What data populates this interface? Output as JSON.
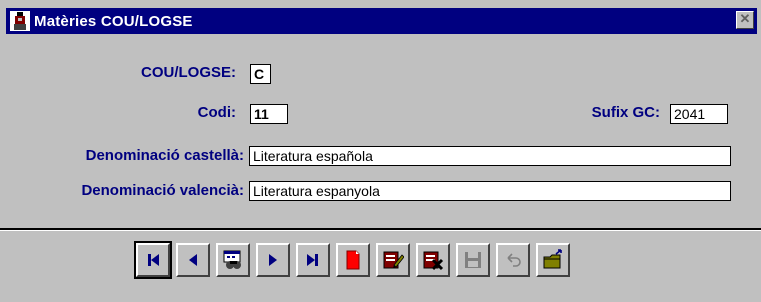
{
  "window": {
    "title": "Matèries COU/LOGSE",
    "close_label": "✕"
  },
  "form": {
    "cou_logse": {
      "label": "COU/LOGSE:",
      "value": "C"
    },
    "codi": {
      "label": "Codi:",
      "value": "11"
    },
    "sufix_gc": {
      "label": "Sufix GC:",
      "value": "2041"
    },
    "denominacio_castella": {
      "label": "Denominació castellà:",
      "value": "Literatura española"
    },
    "denominacio_valencia": {
      "label": "Denominació valencià:",
      "value": "Literatura espanyola"
    }
  },
  "toolbar": {
    "icons": [
      "first-record-icon",
      "previous-record-icon",
      "find-icon",
      "next-record-icon",
      "last-record-icon",
      "new-record-icon",
      "edit-record-icon",
      "delete-record-icon",
      "save-icon",
      "undo-icon",
      "exit-icon"
    ],
    "colors": {
      "nav_blue": "#000080",
      "new_red": "#ff0000",
      "disabled": "#808080"
    }
  }
}
